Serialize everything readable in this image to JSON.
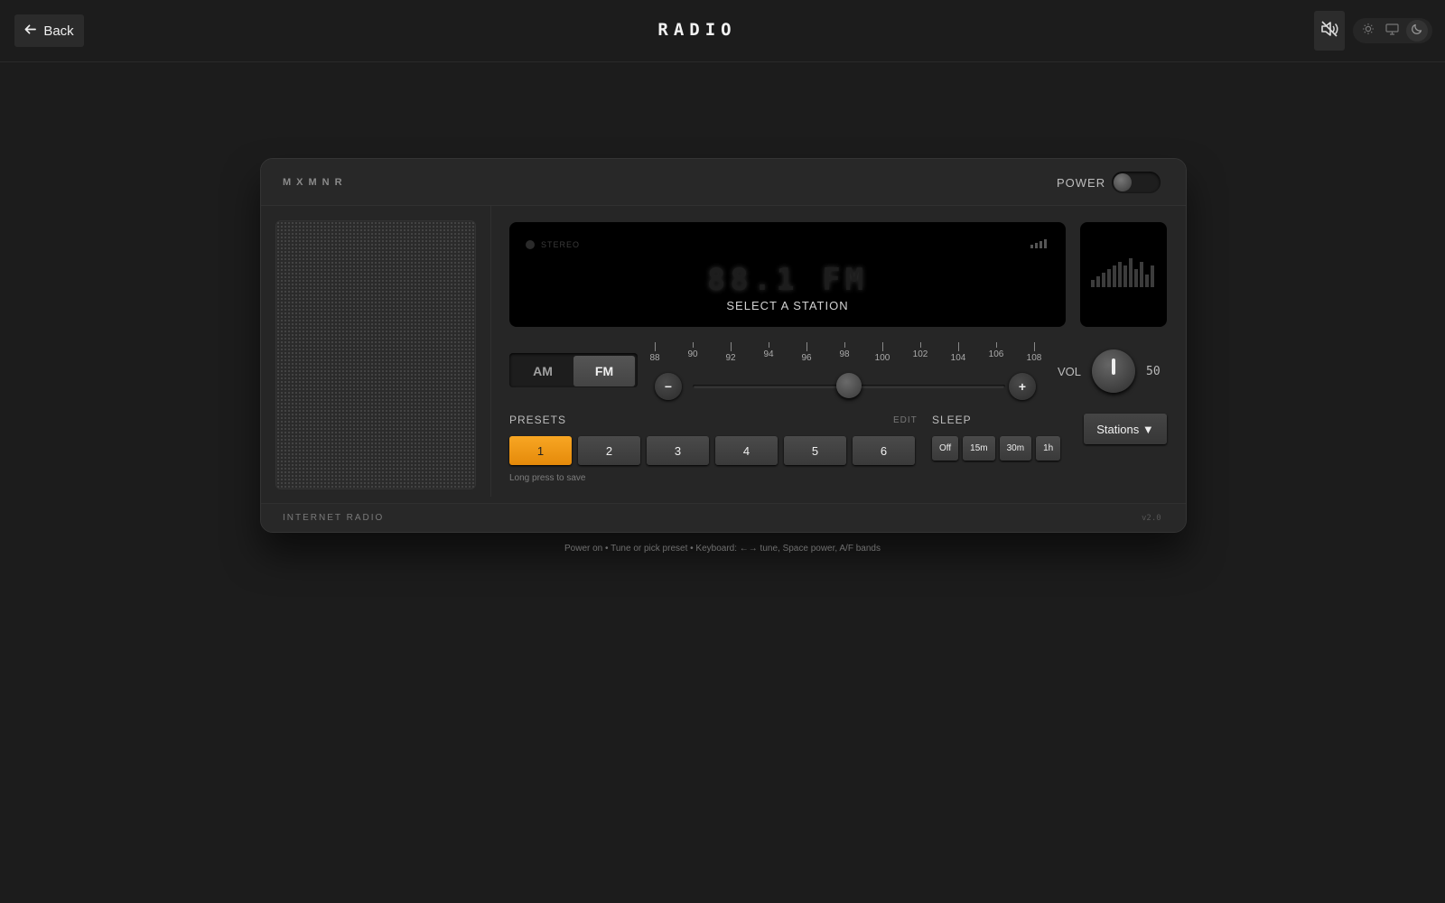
{
  "header": {
    "back_label": "Back",
    "title": "RADIO",
    "mute_icon": "speaker-muted-icon",
    "theme_options": [
      {
        "name": "sun-icon",
        "active": false
      },
      {
        "name": "monitor-icon",
        "active": false
      },
      {
        "name": "moon-icon",
        "active": true
      }
    ]
  },
  "radio": {
    "brand": "MXMNR",
    "power_label": "POWER",
    "power_on": false,
    "display": {
      "stereo_label": "STEREO",
      "frequency": "88.1 FM",
      "station": "SELECT A STATION",
      "signal_bars": 4
    },
    "bands": {
      "am": "AM",
      "fm": "FM",
      "selected": "FM"
    },
    "tuner": {
      "ticks": [
        "88",
        "90",
        "92",
        "94",
        "96",
        "98",
        "100",
        "102",
        "104",
        "106",
        "108"
      ],
      "min": 88,
      "max": 108,
      "knob_value": 98,
      "minus": "−",
      "plus": "+"
    },
    "volume": {
      "label": "VOL",
      "value": "50"
    },
    "presets": {
      "label": "PRESETS",
      "edit": "EDIT",
      "buttons": [
        "1",
        "2",
        "3",
        "4",
        "5",
        "6"
      ],
      "active": "1",
      "hint": "Long press to save"
    },
    "sleep": {
      "label": "SLEEP",
      "options": [
        "Off",
        "15m",
        "30m",
        "1h"
      ]
    },
    "stations_button": "Stations ▼",
    "footer_label": "INTERNET RADIO",
    "version": "v2.0"
  },
  "bottom_hint": "Power on • Tune or pick preset • Keyboard: ←→ tune, Space power, A/F bands",
  "colors": {
    "background": "#1c1c1c",
    "panel": "#262626",
    "accent": "#f5a01a",
    "display": "#000000"
  }
}
